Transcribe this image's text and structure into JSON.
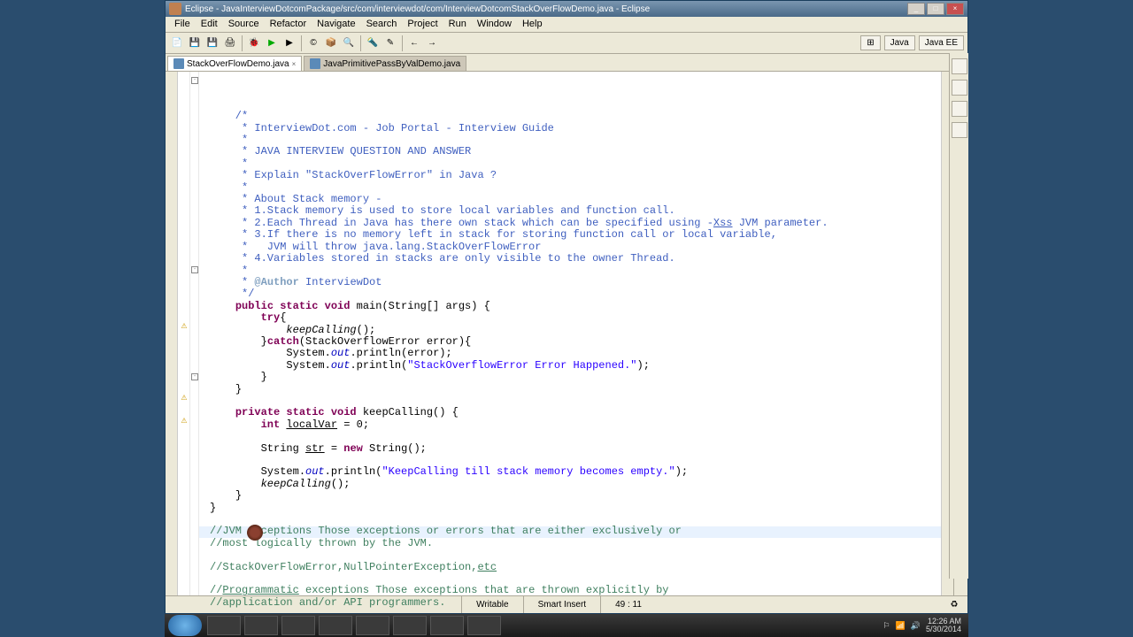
{
  "titlebar": {
    "text": "Eclipse - JavaInterviewDotcomPackage/src/com/interviewdot/com/InterviewDotcomStackOverFlowDemo.java - Eclipse"
  },
  "menu": [
    "File",
    "Edit",
    "Source",
    "Refactor",
    "Navigate",
    "Search",
    "Project",
    "Run",
    "Window",
    "Help"
  ],
  "perspective": {
    "label": "Java",
    "other": "Java EE"
  },
  "tabs": [
    {
      "label": "StackOverFlowDemo.java",
      "active": true
    },
    {
      "label": "JavaPrimitivePassByValDemo.java",
      "active": false
    }
  ],
  "code": {
    "c1": "    /*",
    "c2": "     * InterviewDot.com - Job Portal - Interview Guide",
    "c3": "     *",
    "c4": "     * JAVA INTERVIEW QUESTION AND ANSWER",
    "c5": "     *",
    "c6": "     * Explain \"StackOverFlowError\" in Java ?",
    "c7": "     *",
    "c8": "     * About Stack memory -",
    "c9": "     * 1.Stack memory is used to store local variables and function call.",
    "c10": "     * 2.Each Thread in Java has there own stack which can be specified using -",
    "c10b": "Xss",
    "c10c": " JVM parameter.",
    "c11": "     * 3.If there is no memory left in stack for storing function call or local variable,",
    "c12": "     *   JVM will throw java.lang.StackOverFlowError",
    "c13": "     * 4.Variables stored in stacks are only visible to the owner Thread.",
    "c14": "     *",
    "c15": "     * ",
    "c15tag": "@Author",
    "c15b": " InterviewDot",
    "c16": "     */",
    "m1a": "public static void",
    "m1b": " main(String[] args) {",
    "m2a": "try",
    "m2b": "{",
    "m3": "keepCalling",
    "m3b": "();",
    "m4a": "}",
    "m4b": "catch",
    "m4c": "(StackOverflowError error){",
    "m5a": "System.",
    "m5out": "out",
    "m5b": ".println(error);",
    "m6a": "System.",
    "m6b": ".println(",
    "m6str": "\"StackOverflowError Error Happened.\"",
    "m6c": ");",
    "m7": "}",
    "m8": "}",
    "k1a": "private static void",
    "k1b": " keepCalling() {",
    "k2a": "int",
    "k2b": " ",
    "k2var": "localVar",
    "k2c": " = 0;",
    "k3a": "String ",
    "k3var": "str",
    "k3b": " = ",
    "k3new": "new",
    "k3c": " String();",
    "k4a": "System.",
    "k4b": ".println(",
    "k4str": "\"KeepCalling till stack memory becomes empty.\"",
    "k4c": ");",
    "k5": "keepCalling",
    "k5b": "();",
    "k6": "}",
    "k7": "}",
    "jvm1": "//JVM",
    "jvm1b": " exceptions Those exceptions or errors that are either exclusively or",
    "jvm2": "//most logically thrown by the JVM.",
    "soe1": "//StackOverFlowError,NullPointerException,",
    "soe1b": "etc",
    "prog1": "//",
    "prog1u": "Programmatic",
    "prog1b": " exceptions Those exceptions that are thrown explicitly by",
    "prog2": "//application and/or API programmers."
  },
  "status": {
    "writable": "Writable",
    "insert": "Smart Insert",
    "pos": "49 : 11"
  },
  "tray": {
    "time": "12:26 AM",
    "date": "5/30/2014"
  }
}
